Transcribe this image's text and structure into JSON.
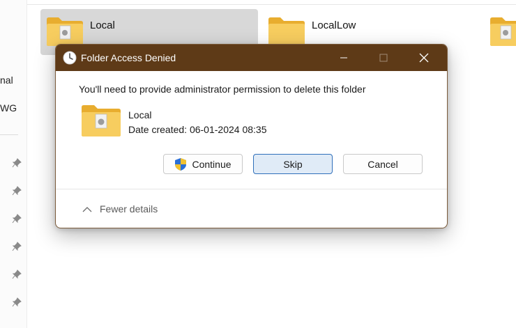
{
  "explorer": {
    "left_labels": [
      "nal",
      "WG"
    ],
    "folders": [
      {
        "name": "Local",
        "selected": true
      },
      {
        "name": "LocalLow",
        "selected": false
      }
    ],
    "pin_icon": "pin-icon",
    "folder_color": "#f4c553"
  },
  "dialog": {
    "title": "Folder Access Denied",
    "title_icon": "clock-icon",
    "titlebar_color": "#5e3a17",
    "message": "You'll need to provide administrator permission to delete this folder",
    "item": {
      "name": "Local",
      "date_created": "Date created: 06-01-2024 08:35"
    },
    "buttons": {
      "continue": "Continue",
      "skip": "Skip",
      "cancel": "Cancel"
    },
    "details_toggle": "Fewer details"
  }
}
